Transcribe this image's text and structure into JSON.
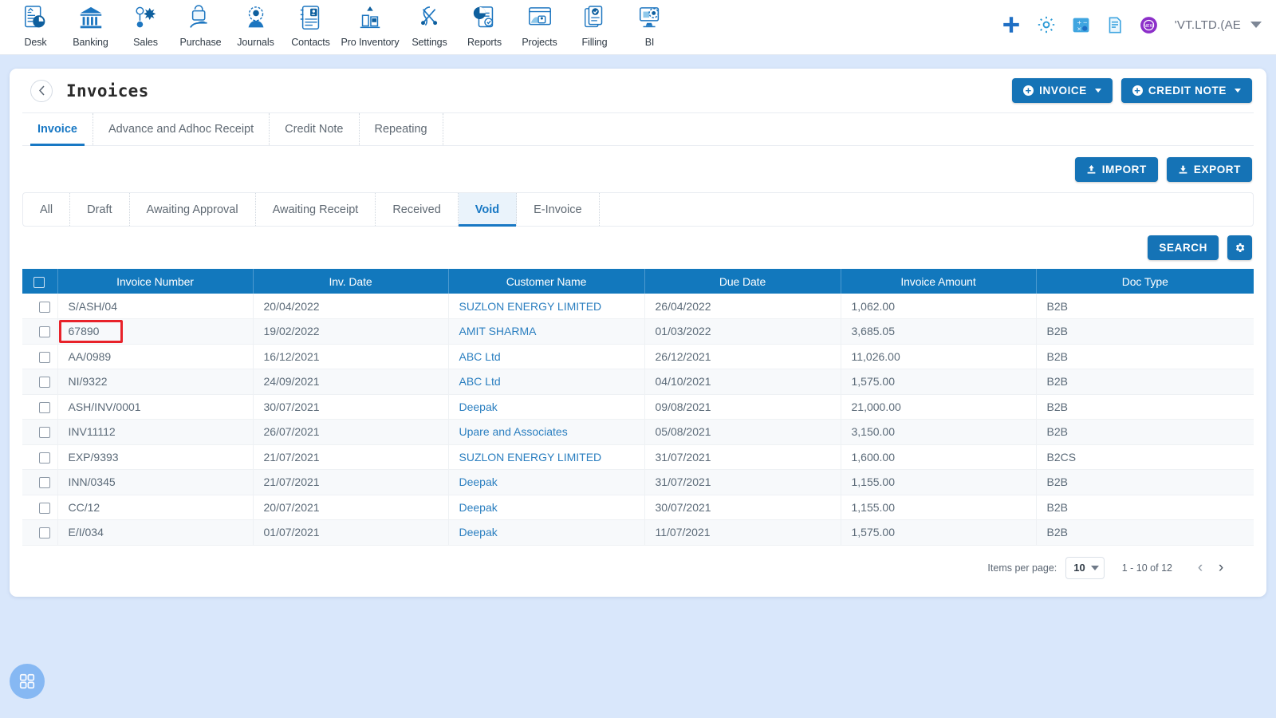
{
  "topnav": {
    "items": [
      {
        "label": "Desk",
        "icon": "dashboard-icon"
      },
      {
        "label": "Banking",
        "icon": "bank-icon"
      },
      {
        "label": "Sales",
        "icon": "sales-icon"
      },
      {
        "label": "Purchase",
        "icon": "purchase-icon"
      },
      {
        "label": "Journals",
        "icon": "journals-icon"
      },
      {
        "label": "Contacts",
        "icon": "contacts-icon"
      },
      {
        "label": "Pro Inventory",
        "icon": "inventory-icon"
      },
      {
        "label": "Settings",
        "icon": "settings-icon"
      },
      {
        "label": "Reports",
        "icon": "reports-icon"
      },
      {
        "label": "Projects",
        "icon": "projects-icon"
      },
      {
        "label": "Filling",
        "icon": "filling-icon"
      },
      {
        "label": "BI",
        "icon": "bi-icon"
      }
    ],
    "right_icons": [
      "plus-icon",
      "gear-icon",
      "calculator-icon",
      "notes-icon",
      "help-badge-icon"
    ],
    "company": "'VT.LTD.(AE"
  },
  "header": {
    "back": "‹",
    "title": "Invoices",
    "invoice_button": "INVOICE",
    "credit_note_button": "CREDIT NOTE"
  },
  "primary_tabs": [
    {
      "label": "Invoice",
      "active": true
    },
    {
      "label": "Advance and Adhoc Receipt",
      "active": false
    },
    {
      "label": "Credit Note",
      "active": false
    },
    {
      "label": "Repeating",
      "active": false
    }
  ],
  "toolbar": {
    "import_label": "IMPORT",
    "export_label": "EXPORT",
    "search_label": "SEARCH",
    "settings_icon": "gear-icon"
  },
  "status_tabs": [
    {
      "label": "All",
      "active": false
    },
    {
      "label": "Draft",
      "active": false
    },
    {
      "label": "Awaiting Approval",
      "active": false
    },
    {
      "label": "Awaiting Receipt",
      "active": false
    },
    {
      "label": "Received",
      "active": false
    },
    {
      "label": "Void",
      "active": true
    },
    {
      "label": "E-Invoice",
      "active": false
    }
  ],
  "table": {
    "columns": [
      "Invoice Number",
      "Inv. Date",
      "Customer Name",
      "Due Date",
      "Invoice Amount",
      "Doc Type"
    ],
    "rows": [
      {
        "invoice_number": "S/ASH/04",
        "inv_date": "20/04/2022",
        "customer": "SUZLON ENERGY LIMITED",
        "due_date": "26/04/2022",
        "amount": "1,062.00",
        "doc_type": "B2B",
        "highlighted": false
      },
      {
        "invoice_number": "67890",
        "inv_date": "19/02/2022",
        "customer": "AMIT SHARMA",
        "due_date": "01/03/2022",
        "amount": "3,685.05",
        "doc_type": "B2B",
        "highlighted": true
      },
      {
        "invoice_number": "AA/0989",
        "inv_date": "16/12/2021",
        "customer": "ABC Ltd",
        "due_date": "26/12/2021",
        "amount": "11,026.00",
        "doc_type": "B2B",
        "highlighted": false
      },
      {
        "invoice_number": "NI/9322",
        "inv_date": "24/09/2021",
        "customer": "ABC Ltd",
        "due_date": "04/10/2021",
        "amount": "1,575.00",
        "doc_type": "B2B",
        "highlighted": false
      },
      {
        "invoice_number": "ASH/INV/0001",
        "inv_date": "30/07/2021",
        "customer": "Deepak",
        "due_date": "09/08/2021",
        "amount": "21,000.00",
        "doc_type": "B2B",
        "highlighted": false
      },
      {
        "invoice_number": "INV11112",
        "inv_date": "26/07/2021",
        "customer": "Upare and Associates",
        "due_date": "05/08/2021",
        "amount": "3,150.00",
        "doc_type": "B2B",
        "highlighted": false
      },
      {
        "invoice_number": "EXP/9393",
        "inv_date": "21/07/2021",
        "customer": "SUZLON ENERGY LIMITED",
        "due_date": "31/07/2021",
        "amount": "1,600.00",
        "doc_type": "B2CS",
        "highlighted": false
      },
      {
        "invoice_number": "INN/0345",
        "inv_date": "21/07/2021",
        "customer": "Deepak",
        "due_date": "31/07/2021",
        "amount": "1,155.00",
        "doc_type": "B2B",
        "highlighted": false
      },
      {
        "invoice_number": "CC/12",
        "inv_date": "20/07/2021",
        "customer": "Deepak",
        "due_date": "30/07/2021",
        "amount": "1,155.00",
        "doc_type": "B2B",
        "highlighted": false
      },
      {
        "invoice_number": "E/I/034",
        "inv_date": "01/07/2021",
        "customer": "Deepak",
        "due_date": "11/07/2021",
        "amount": "1,575.00",
        "doc_type": "B2B",
        "highlighted": false
      }
    ]
  },
  "pagination": {
    "items_per_page_label": "Items per page:",
    "items_per_page_value": "10",
    "range": "1 - 10 of 12",
    "prev": "‹",
    "next": "›"
  },
  "fab": {
    "icon": "apps-grid-icon"
  },
  "colors": {
    "accent": "#1278bd",
    "header_blue": "#1278bd",
    "page_background": "#d9e7fb",
    "link": "#2b7fc0",
    "highlight_red": "#e8222a"
  }
}
